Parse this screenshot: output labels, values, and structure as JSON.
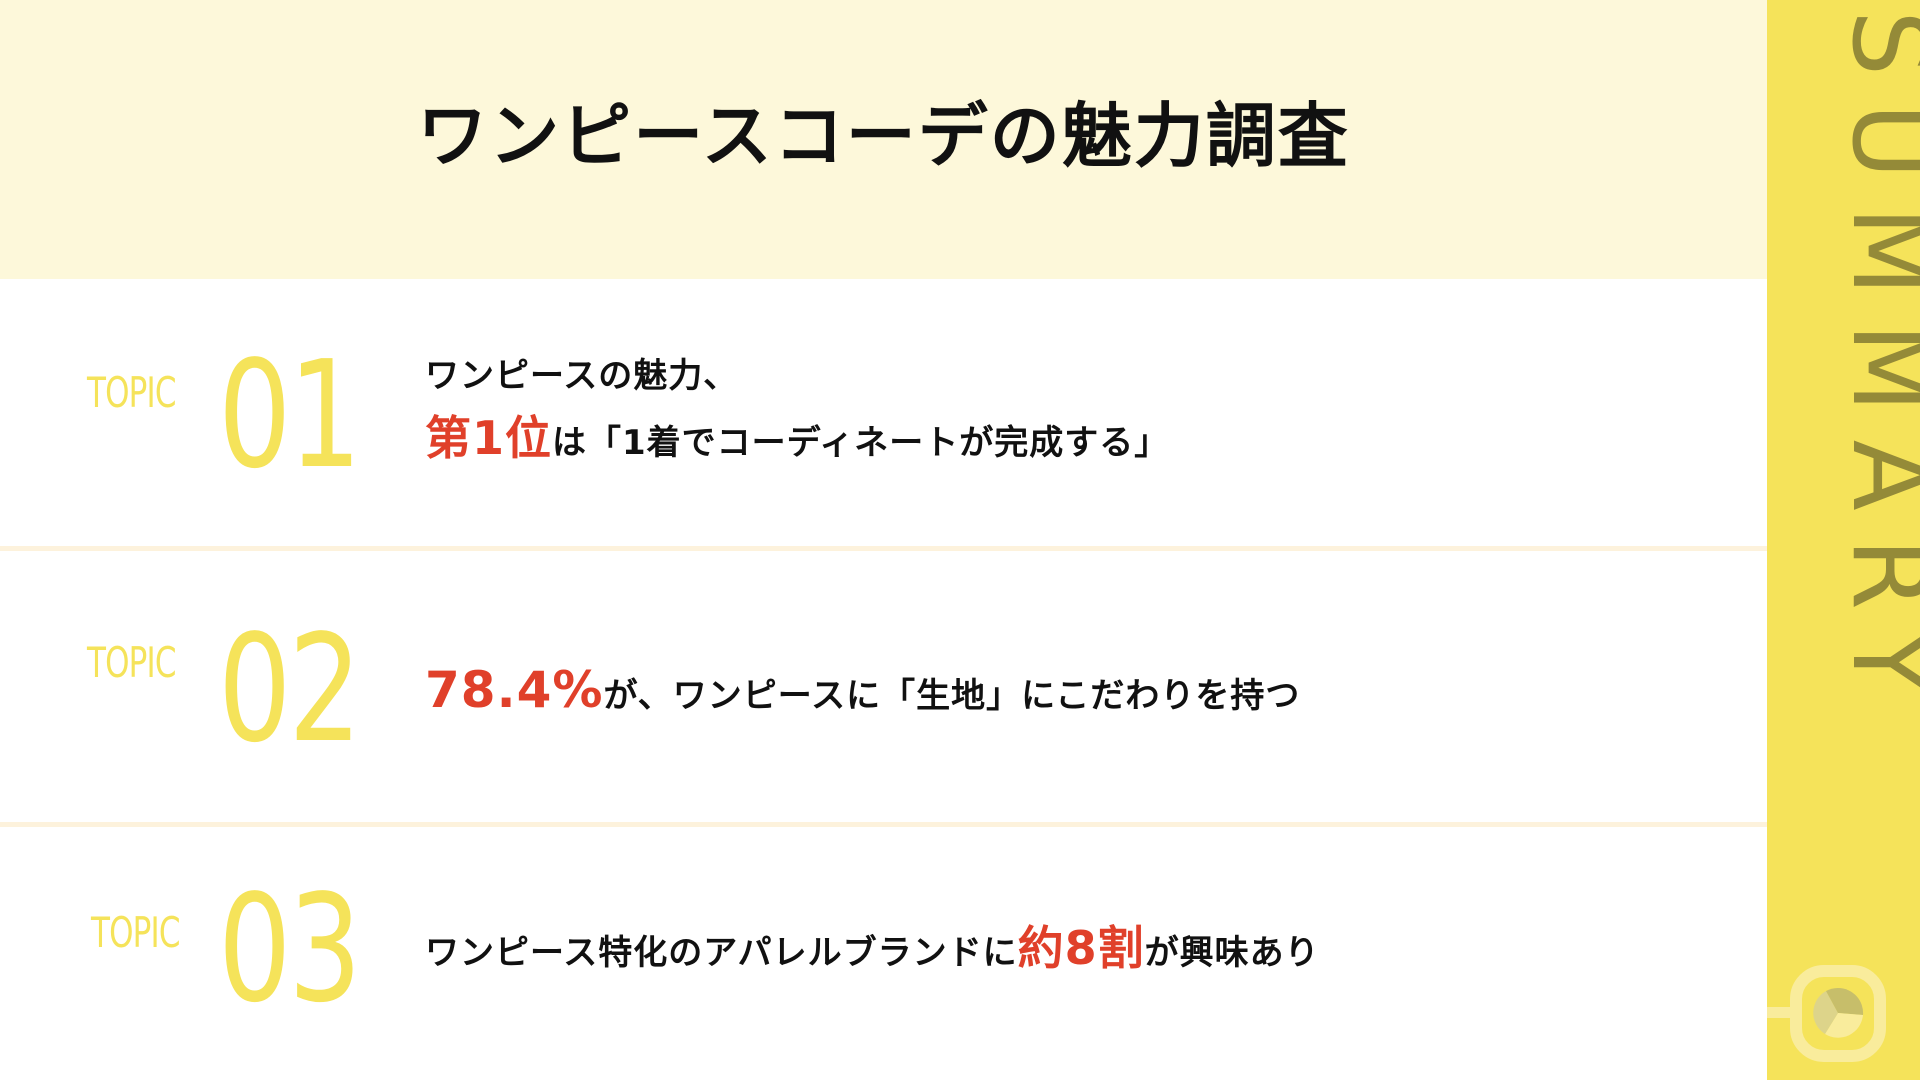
{
  "header": {
    "title": "ワンピースコーデの魅力調査"
  },
  "sidebar": {
    "label": "SUMMARY",
    "icon": "pie-chart-icon"
  },
  "colors": {
    "header_bg": "#fdf8da",
    "accent_yellow": "#f5e35a",
    "sidebar_text": "#948a38",
    "highlight_red": "#e0402a",
    "divider": "#fdf2dc"
  },
  "topics": [
    {
      "label": "TOPIC",
      "number": "01",
      "line1": "ワンピースの魅力、",
      "highlight": "第1位",
      "rest": "は「1着でコーディネートが完成する」"
    },
    {
      "label": "TOPIC",
      "number": "02",
      "highlight": "78.4%",
      "rest": "が、ワンピースに「生地」にこだわりを持つ"
    },
    {
      "label": "TOPIC",
      "number": "03",
      "before": "ワンピース特化のアパレルブランドに",
      "highlight": "約8割",
      "rest": "が興味あり"
    }
  ]
}
